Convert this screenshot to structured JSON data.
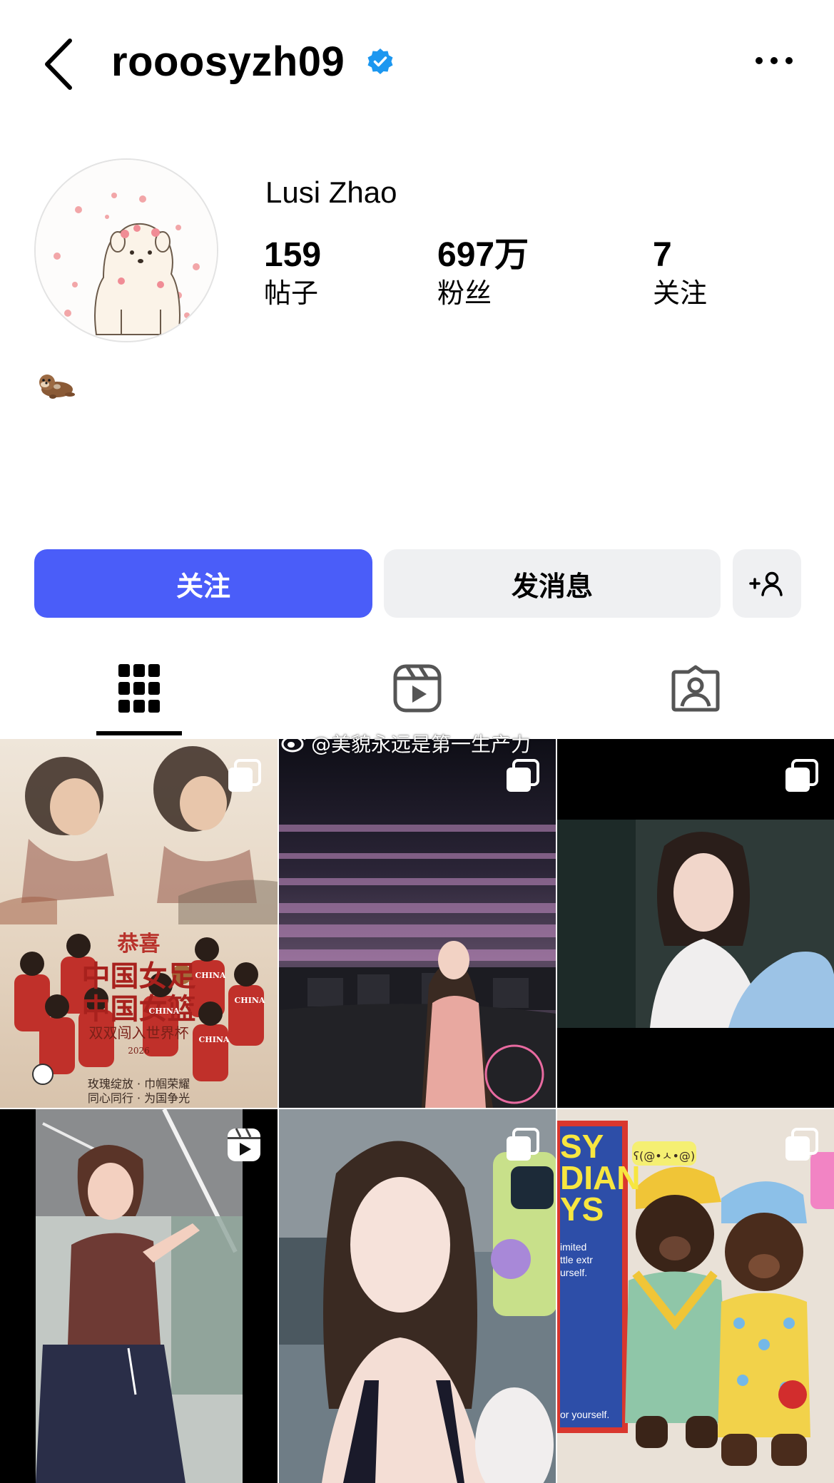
{
  "header": {
    "username": "rooosyzh09",
    "back_icon": "chevron-left-icon",
    "verified_icon": "verified-badge-icon",
    "more_icon": "more-horizontal-icon",
    "verified_color": "#1da1f2"
  },
  "profile": {
    "display_name": "Lusi Zhao",
    "bio_emoji": "otter",
    "stats": [
      {
        "value": "159",
        "label": "帖子"
      },
      {
        "value": "697万",
        "label": "粉丝"
      },
      {
        "value": "7",
        "label": "关注"
      }
    ]
  },
  "actions": {
    "follow_label": "关注",
    "message_label": "发消息",
    "add_person_icon": "add-person-icon",
    "follow_color": "#4a5df9",
    "secondary_color": "#eff0f2"
  },
  "tabs": [
    {
      "name": "posts",
      "icon": "grid-icon",
      "active": true
    },
    {
      "name": "reels",
      "icon": "reels-icon",
      "active": false
    },
    {
      "name": "tagged",
      "icon": "tagged-person-icon",
      "active": false
    }
  ],
  "watermark": "@美貌永远是第一生产力",
  "posts": [
    {
      "type": "carousel",
      "description": "poster",
      "poster": {
        "top": "恭喜",
        "line1": "中国女足",
        "line2": "中国女篮",
        "line3": "双双闯入世界杯",
        "year": "2026",
        "footer1": "玫瑰绽放 · 巾帼荣耀",
        "footer2": "同心同行 · 为国争光",
        "jerseys": [
          "CHINA",
          "CHINA",
          "CHINA",
          "CHINA"
        ]
      }
    },
    {
      "type": "carousel",
      "description": "concert"
    },
    {
      "type": "carousel",
      "description": "portrait"
    },
    {
      "type": "reel",
      "description": "dance"
    },
    {
      "type": "carousel",
      "description": "selfie"
    },
    {
      "type": "carousel",
      "description": "plush-toys",
      "sign_lines": [
        "SY",
        "DIAN",
        "YS"
      ],
      "sign_small": [
        "imited",
        "ttle extr",
        "urself."
      ],
      "bottom_text": "or yourself.",
      "bubble_text": "ʕ(@•ㅅ•@)"
    }
  ]
}
